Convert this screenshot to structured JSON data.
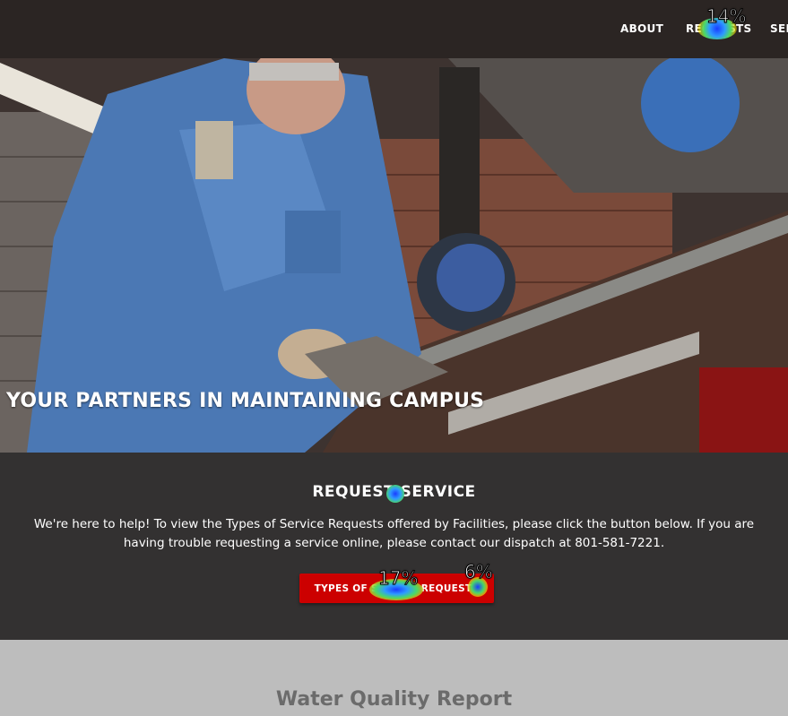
{
  "nav": {
    "about": "ABOUT",
    "requests": "REQUESTS",
    "services": "SER"
  },
  "hero": {
    "title": "YOUR PARTNERS IN MAINTAINING CAMPUS"
  },
  "request_service": {
    "heading": "REQUEST SERVICE",
    "body": "We're here to help! To view the Types of Service Requests offered by Facilities, please click the button below. If you are having trouble requesting a service online, please contact our dispatch at 801-581-7221.",
    "button_label": "TYPES OF SERVICE REQUESTS"
  },
  "water_quality": {
    "title": "Water Quality Report"
  },
  "heatmap": {
    "requests_nav": "14%",
    "types_button_center": "17%",
    "types_button_right": "6%"
  },
  "colors": {
    "header_bg": "#2b2523",
    "panel_bg": "#333131",
    "button_red": "#cc0000",
    "water_bg": "#bdbdbd"
  }
}
